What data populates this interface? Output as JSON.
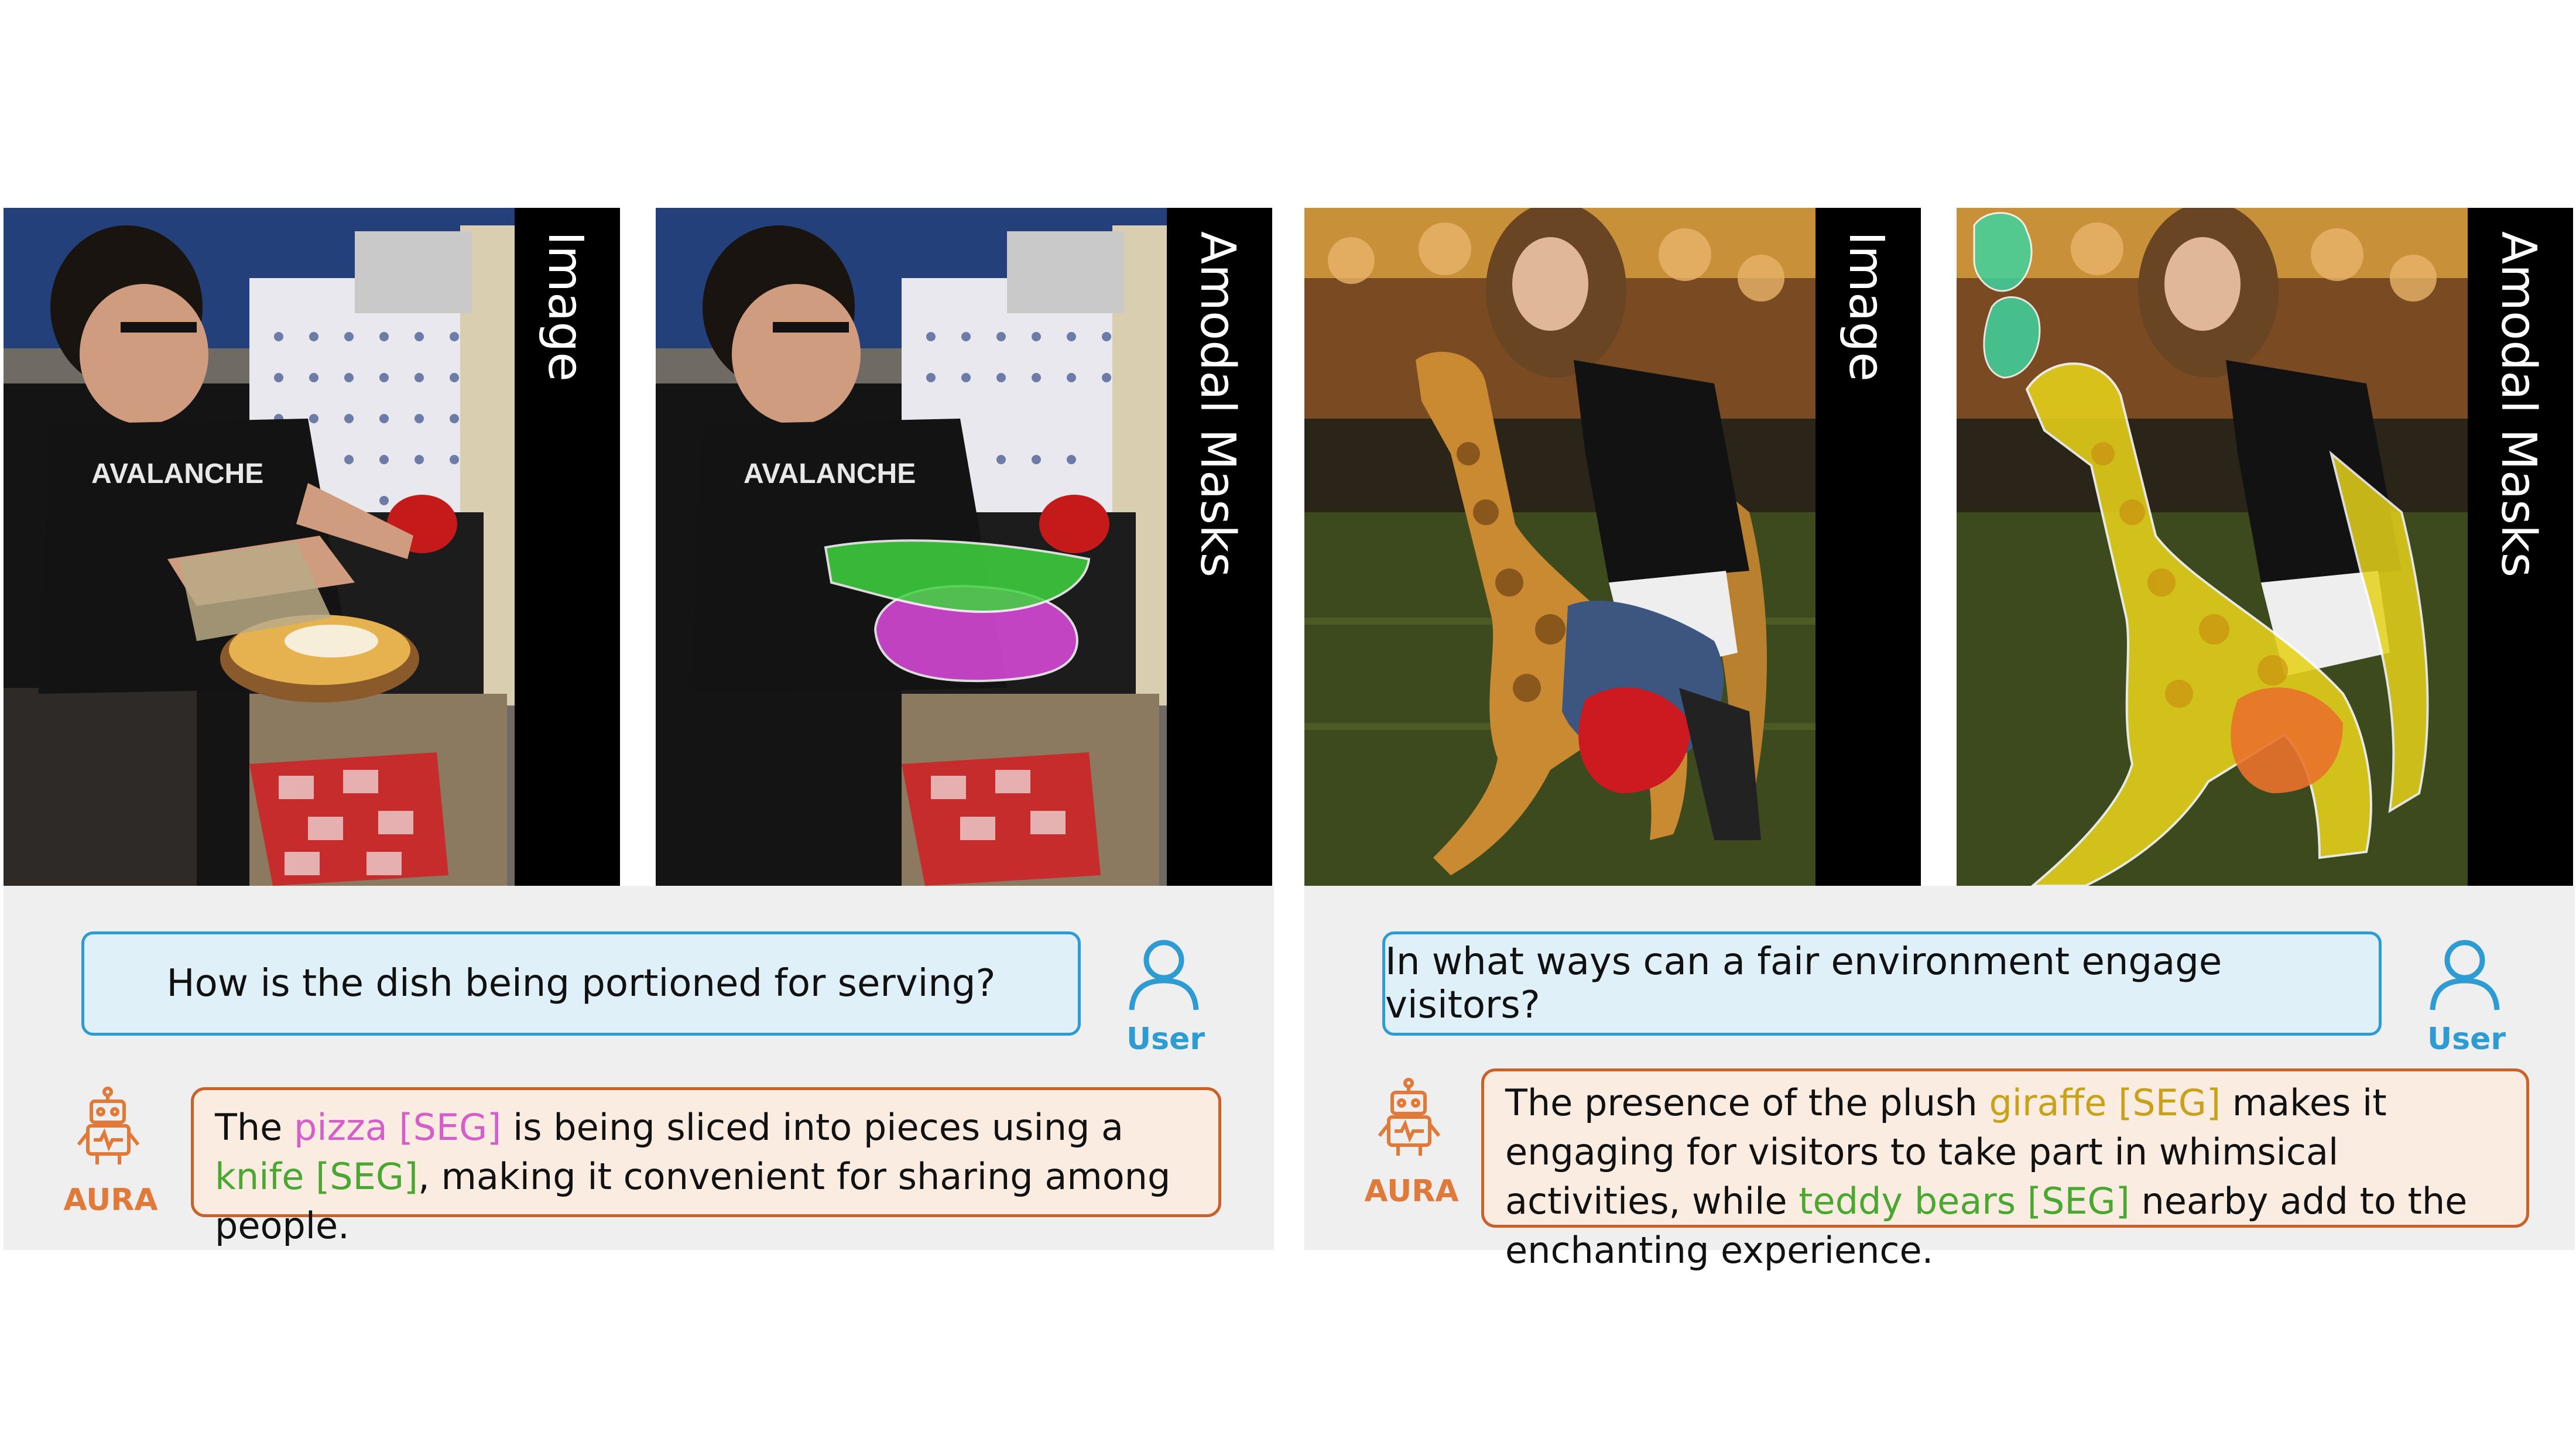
{
  "panels": [
    {
      "image_label": "Image",
      "mask_label": "Amodal Masks",
      "question": "How is the dish being portioned for serving?",
      "user_label": "User",
      "assistant_label": "AURA",
      "answer": {
        "t1": "The ",
        "obj1": "pizza [SEG]",
        "t2": " is being sliced into pieces using a ",
        "obj2": "knife [SEG]",
        "t3": ", making it convenient for sharing among people."
      },
      "colors": {
        "obj1": "#d45fc9",
        "obj2": "#4aa832"
      }
    },
    {
      "image_label": "Image",
      "mask_label": "Amodal Masks",
      "question": "In what ways can a fair environment engage visitors?",
      "user_label": "User",
      "assistant_label": "AURA",
      "answer": {
        "t1": "The presence of the plush ",
        "obj1": "giraffe [SEG]",
        "t2": " makes it engaging for visitors to take part in whimsical activities, while ",
        "obj2": "teddy bears [SEG]",
        "t3": " nearby add to the enchanting experience."
      },
      "colors": {
        "obj1": "#c9a21b",
        "obj2": "#4aa832"
      }
    }
  ]
}
